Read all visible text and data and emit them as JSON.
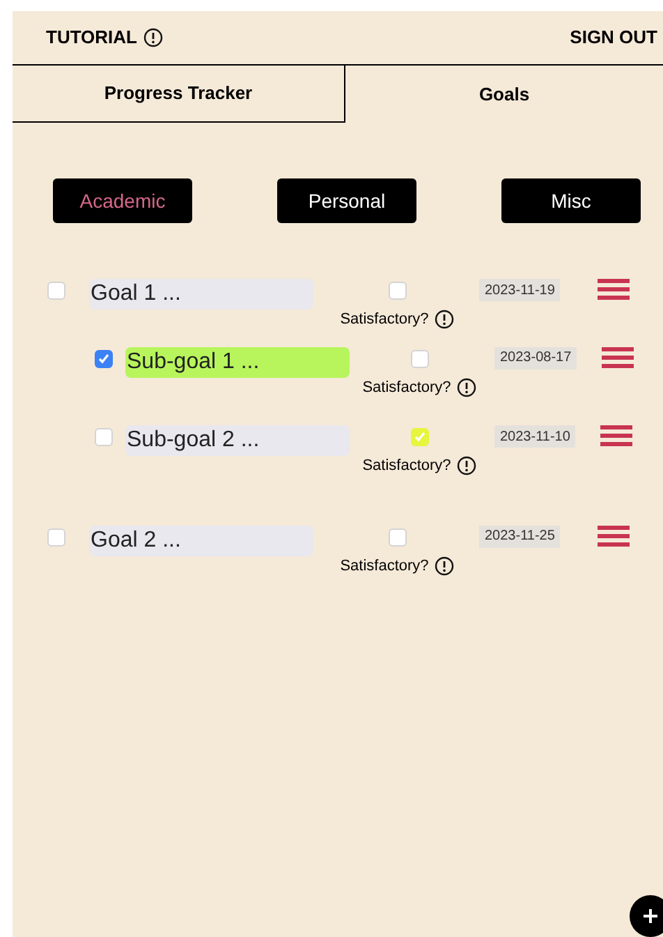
{
  "header": {
    "tutorial": "TUTORIAL",
    "sign_out": "SIGN OUT"
  },
  "tabs": [
    {
      "label": "Progress Tracker",
      "selected": false
    },
    {
      "label": "Goals",
      "selected": true
    }
  ],
  "categories": [
    {
      "label": "Academic",
      "selected": true
    },
    {
      "label": "Personal",
      "selected": false
    },
    {
      "label": "Misc",
      "selected": false
    }
  ],
  "goals": [
    {
      "title": "Goal 1 ...",
      "done": false,
      "satisfactory": false,
      "satisfactory_label": "Satisfactory?",
      "date": "2023-11-19",
      "children": [
        {
          "title": "Sub-goal 1 ...",
          "done": true,
          "satisfactory": false,
          "satisfactory_label": "Satisfactory?",
          "date": "2023-08-17"
        },
        {
          "title": "Sub-goal 2 ...",
          "done": false,
          "satisfactory": true,
          "satisfactory_label": "Satisfactory?",
          "date": "2023-11-10"
        }
      ]
    },
    {
      "title": "Goal 2 ...",
      "done": false,
      "satisfactory": false,
      "satisfactory_label": "Satisfactory?",
      "date": "2023-11-25"
    }
  ]
}
